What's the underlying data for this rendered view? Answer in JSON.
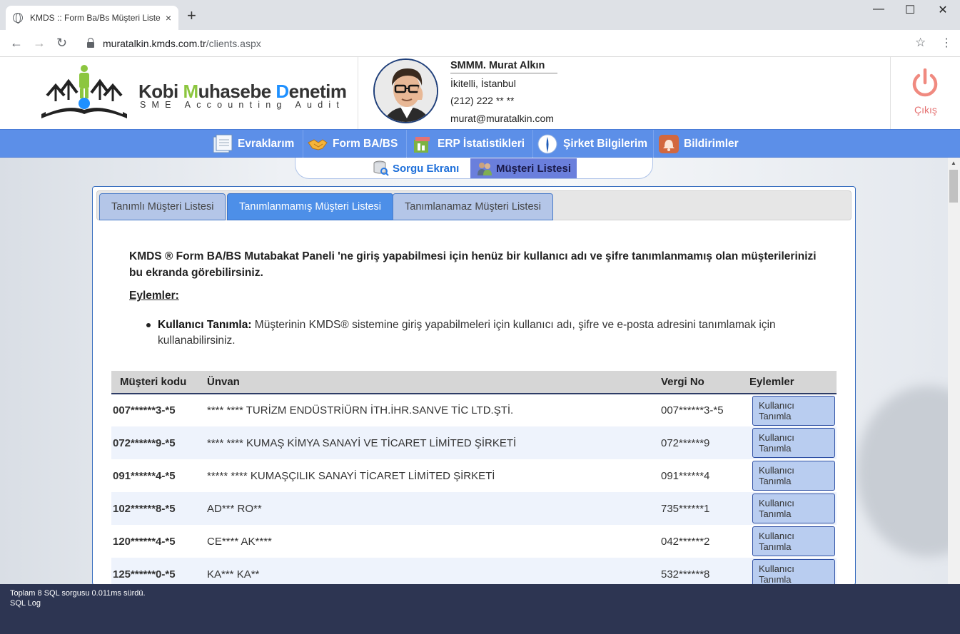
{
  "browser": {
    "tab_title": "KMDS :: Form Ba/Bs Müşteri Liste",
    "tab_close": "×",
    "new_tab": "+",
    "minimize": "—",
    "maximize": "☐",
    "close": "✕",
    "url_host": "muratalkin.kmds.com.tr",
    "url_path": "/clients.aspx"
  },
  "header": {
    "logo_word1_first": "Kobi ",
    "logo_word2": "M",
    "logo_word2_rest": "uhasebe ",
    "logo_word3": "D",
    "logo_word3_rest": "enetim",
    "logo_subtitle": "SME Accounting Audit",
    "user_name": "SMMM. Murat Alkın",
    "user_location": "İkitelli, İstanbul",
    "user_phone": "(212) 222 ** **",
    "user_email": "murat@muratalkin.com",
    "logout_label": "Çıkış"
  },
  "main_nav": {
    "items": [
      {
        "label": "Evraklarım",
        "icon": "documents-icon"
      },
      {
        "label": "Form BA/BS",
        "icon": "handshake-icon"
      },
      {
        "label": "ERP İstatistikleri",
        "icon": "stats-icon"
      },
      {
        "label": "Şirket Bilgilerim",
        "icon": "info-icon"
      },
      {
        "label": "Bildirimler",
        "icon": "bell-icon"
      }
    ]
  },
  "sub_nav": {
    "items": [
      {
        "label": "Sorgu Ekranı",
        "icon": "database-search-icon"
      },
      {
        "label": "Müşteri Listesi",
        "icon": "users-icon"
      }
    ]
  },
  "panel_tabs": [
    {
      "label": "Tanımlı Müşteri Listesi"
    },
    {
      "label": "Tanımlanmamış Müşteri Listesi"
    },
    {
      "label": "Tanımlanamaz Müşteri Listesi"
    }
  ],
  "content": {
    "intro": "KMDS ® Form BA/BS Mutabakat Paneli 'ne giriş yapabilmesi için henüz bir kullanıcı adı ve şifre tanımlanmamış olan müşterilerinizi bu ekranda görebilirsiniz.",
    "actions_heading": "Eylemler:",
    "bullet_title": "Kullanıcı Tanımla:",
    "bullet_text": " Müşterinin KMDS® sistemine giriş yapabilmeleri için kullanıcı adı, şifre ve e-posta adresini tanımlamak için kullanabilirsiniz."
  },
  "table": {
    "headers": [
      "Müşteri kodu",
      "Ünvan",
      "Vergi No",
      "Eylemler"
    ],
    "action_label": "Kullanıcı Tanımla",
    "rows": [
      {
        "code": "007******3-*5",
        "title": "**** **** TURİZM ENDÜSTRİÜRN İTH.İHR.SANVE TİC LTD.ŞTİ.",
        "tax": "007******3-*5"
      },
      {
        "code": "072******9-*5",
        "title": "**** **** KUMAŞ KİMYA SANAYİ VE TİCARET LİMİTED ŞİRKETİ",
        "tax": "072******9"
      },
      {
        "code": "091******4-*5",
        "title": "***** **** KUMAŞÇILIK SANAYİ TİCARET LİMİTED ŞİRKETİ",
        "tax": "091******4"
      },
      {
        "code": "102******8-*5",
        "title": "AD*** RO**",
        "tax": "735******1"
      },
      {
        "code": "120******4-*5",
        "title": "CE**** AK****",
        "tax": "042******2"
      },
      {
        "code": "125******0-*5",
        "title": "KA*** KA**",
        "tax": "532******8"
      }
    ]
  },
  "footer": {
    "line1": "Toplam 8 SQL sorgusu 0.011ms sürdü.",
    "line2": "SQL Log"
  }
}
